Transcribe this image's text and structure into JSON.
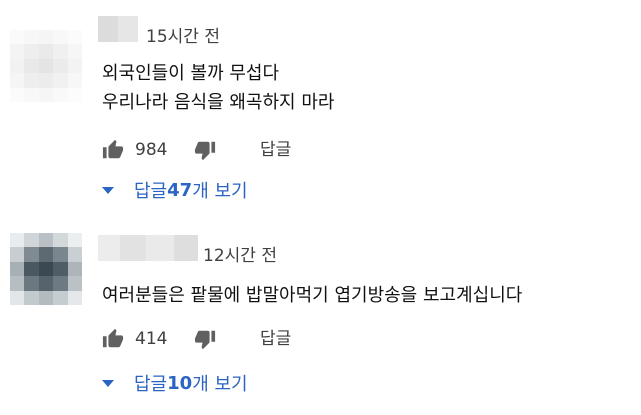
{
  "comments": [
    {
      "time": "15시간 전",
      "lines": [
        "외국인들이 볼까 무섭다",
        "우리나라 음식을 왜곡하지 마라"
      ],
      "like_count": "984",
      "reply_label": "답글",
      "view_replies": {
        "prefix": "답글 ",
        "count": "47",
        "suffix": "개 보기"
      }
    },
    {
      "time": "12시간 전",
      "lines": [
        "여러분들은 팥물에 밥말아먹기 엽기방송을 보고계십니다"
      ],
      "like_count": "414",
      "reply_label": "답글",
      "view_replies": {
        "prefix": "답글 ",
        "count": "10",
        "suffix": "개 보기"
      }
    }
  ],
  "icons": {
    "like": "thumbs-up-icon",
    "dislike": "thumbs-down-icon",
    "expand": "caret-down-icon",
    "avatar": "blurred-avatar"
  },
  "colors": {
    "link_blue": "#2b64c2",
    "icon_gray": "#606060",
    "meta_gray": "#404040"
  }
}
